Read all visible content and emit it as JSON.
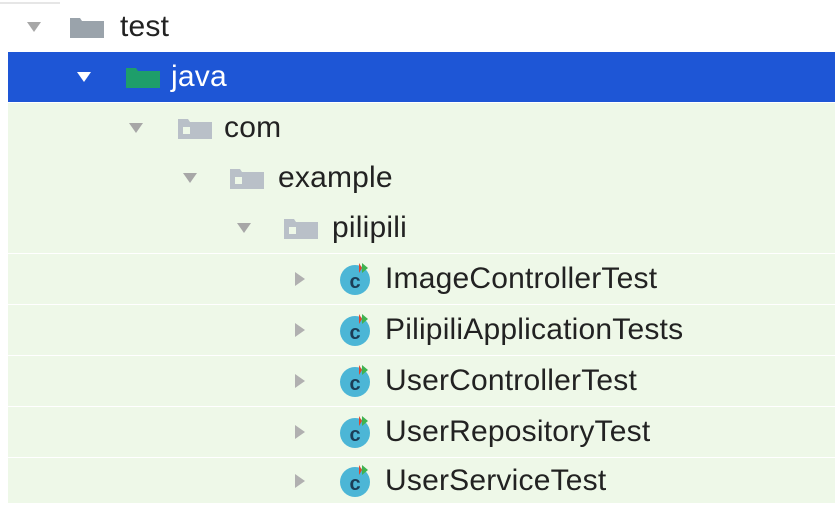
{
  "tree": {
    "nodes": [
      {
        "label": "test",
        "kind": "folder",
        "expanded": true,
        "selected": false
      },
      {
        "label": "java",
        "kind": "test-source-root",
        "expanded": true,
        "selected": true
      },
      {
        "label": "com",
        "kind": "package",
        "expanded": true,
        "selected": false
      },
      {
        "label": "example",
        "kind": "package",
        "expanded": true,
        "selected": false
      },
      {
        "label": "pilipili",
        "kind": "package",
        "expanded": true,
        "selected": false
      },
      {
        "label": "ImageControllerTest",
        "kind": "test-class",
        "expanded": false,
        "selected": false
      },
      {
        "label": "PilipiliApplicationTests",
        "kind": "test-class",
        "expanded": false,
        "selected": false
      },
      {
        "label": "UserControllerTest",
        "kind": "test-class",
        "expanded": false,
        "selected": false
      },
      {
        "label": "UserRepositoryTest",
        "kind": "test-class",
        "expanded": false,
        "selected": false
      },
      {
        "label": "UserServiceTest",
        "kind": "test-class",
        "expanded": false,
        "selected": false
      }
    ]
  },
  "colors": {
    "selection": "#1e56d6",
    "test_source_background": "#eef8e8",
    "test_root_folder": "#1e9e6a",
    "package_folder": "#b9c0c8",
    "plain_folder": "#9aa3ab",
    "class_icon": "#4cb6d6",
    "run_marker_red": "#e0452c",
    "run_marker_green": "#3fb34f"
  },
  "icons": {
    "expanded": "chevron-down-icon",
    "collapsed": "chevron-right-icon",
    "folder": "folder-icon",
    "test_root": "test-source-root-icon",
    "package": "package-icon",
    "test_class": "test-class-icon"
  }
}
